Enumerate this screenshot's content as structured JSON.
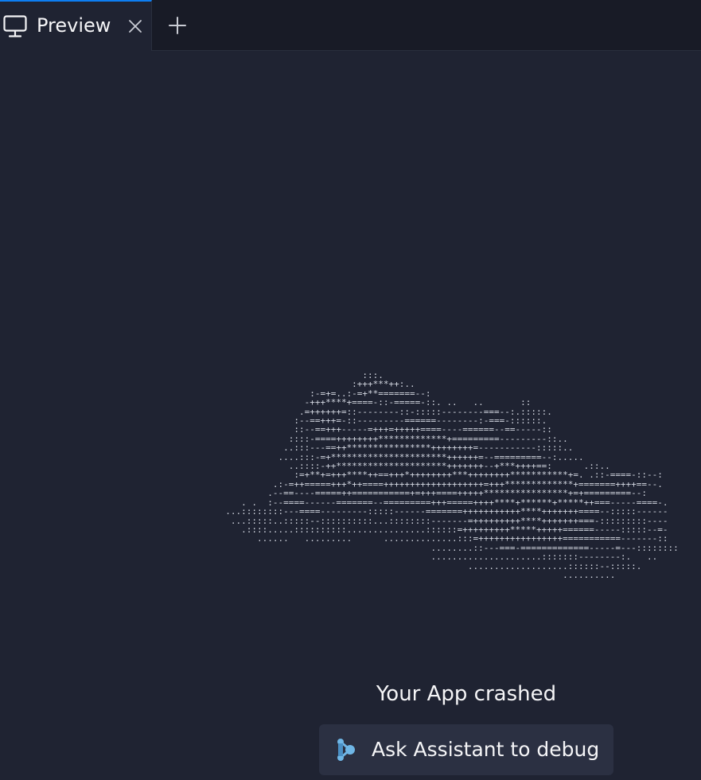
{
  "tabs": [
    {
      "label": "Preview",
      "icon": "monitor-icon",
      "active": true
    }
  ],
  "tab_actions": {
    "close_icon": "close-icon",
    "new_tab_icon": "plus-icon"
  },
  "crash": {
    "ascii_art": "                            :::.\n                          :+++***++:..\n                  :-=+=..:-=+**=======--:\n                 -+++****+====-::-=====-::. ..   ..       ::\n                .=++++++=::--------::-:::::--------===--:.:::::.\n               :--==+++=-::---------======--------:-===-::::::.\n               ::--==+++-----=+++=+++++====----======--==-----::\n              ::::-====++++++++*************+=========---------::..\n             ..:::---==++****************++++++++=-----------:::::..\n            ....:::-=+**********************++++++=--=========--:.....\n              ..::::-++*********************+++++++--+***++++==:      .::..\n               :=+**+=+++****++==+++*++++++++***++++++++***********+=. .::-====-::--:\n           .:-=++=====+++*++====+++++++++++++++++++=+++*************+=======++++==--.\n          .--==----=====++===========+=+++====+++++****************+=+=========--:\n     . .  :--====------=======--=========+++=====++++****+******+*****++===-----====-.\n  ...::::::::---====---------:::::------=======+++++++++++****+++++++====--:::::------\n   ...:::::..:::::--::::::::::...::::::::-------=+++++++++****+++++++===-:::::::::----\n     .::::.....::::::::::...............::::::=+++++++++*****+++++======-----:::::--=-\n        ......   .........      ..............:::=++++++++++++++++===========-------::\n                                         ........::---===-=============-----=---::::::::\n                                         .....................:::::::--------:.   ..\n                                                ...................::::::--:::::.\n                                                                  ..........",
    "message": "Your App crashed",
    "debug_button_label": "Ask Assistant to debug",
    "debug_button_icon": "assistant-icon"
  },
  "colors": {
    "background": "#1f2332",
    "tabbar": "#181b26",
    "active_tab_accent": "#0d7ef2",
    "button_bg": "#2b3042",
    "assistant_icon": "#6fb6e6",
    "text": "#f5f5f7"
  }
}
